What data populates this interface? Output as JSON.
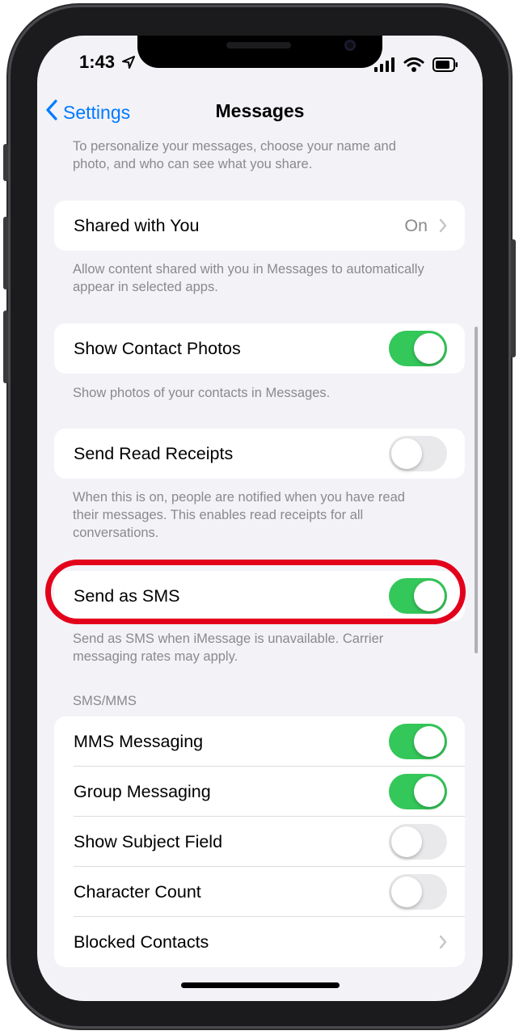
{
  "status": {
    "time": "1:43"
  },
  "nav": {
    "back_label": "Settings",
    "title": "Messages"
  },
  "top_footnote": "To personalize your messages, choose your name and photo, and who can see what you share.",
  "shared_with_you": {
    "label": "Shared with You",
    "value": "On",
    "footnote": "Allow content shared with you in Messages to automatically appear in selected apps."
  },
  "show_contact_photos": {
    "label": "Show Contact Photos",
    "enabled": true,
    "footnote": "Show photos of your contacts in Messages."
  },
  "send_read_receipts": {
    "label": "Send Read Receipts",
    "enabled": false,
    "footnote": "When this is on, people are notified when you have read their messages. This enables read receipts for all conversations."
  },
  "send_as_sms": {
    "label": "Send as SMS",
    "enabled": true,
    "footnote": "Send as SMS when iMessage is unavailable. Carrier messaging rates may apply."
  },
  "sms_mms": {
    "header": "SMS/MMS",
    "items": [
      {
        "label": "MMS Messaging",
        "enabled": true
      },
      {
        "label": "Group Messaging",
        "enabled": true
      },
      {
        "label": "Show Subject Field",
        "enabled": false
      },
      {
        "label": "Character Count",
        "enabled": false
      },
      {
        "label": "Blocked Contacts"
      }
    ]
  },
  "colors": {
    "accent": "#007aff",
    "toggle_on": "#34c759",
    "highlight": "#e3001b"
  }
}
